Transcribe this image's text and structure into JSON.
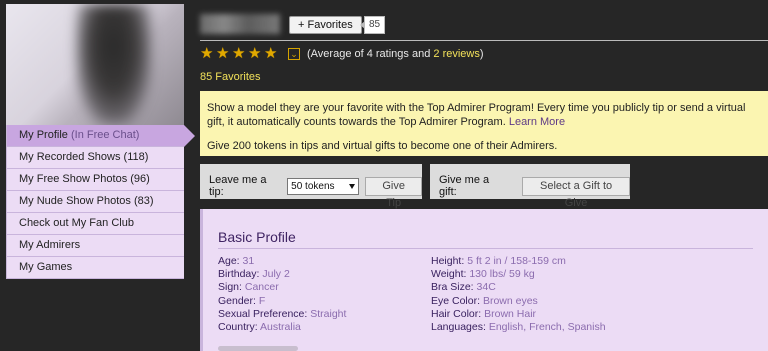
{
  "header": {
    "favorites_button": "+ Favorites",
    "favorites_count": "85",
    "rating_text": "(Average of 4 ratings and ",
    "reviews_link": "2 reviews",
    "rating_text_end": ")",
    "rating_stars": 5,
    "favorites_total": "85 Favorites"
  },
  "sidebar": {
    "items": [
      {
        "label": "My Profile",
        "extra": "(In Free Chat)"
      },
      {
        "label": "My Recorded Shows (118)"
      },
      {
        "label": "My Free Show Photos (96)"
      },
      {
        "label": "My Nude Show Photos (83)"
      },
      {
        "label": "Check out My Fan Club"
      },
      {
        "label": "My Admirers"
      },
      {
        "label": "My Games"
      }
    ]
  },
  "banner": {
    "text": "Show a model they are your favorite with the Top Admirer Program! Every time you publicly tip or send a virtual gift, it automatically counts towards the Top Admirer Program.",
    "learn_more": "Learn More",
    "text2": "Give 200 tokens in tips and virtual gifts to become one of their Admirers."
  },
  "tip": {
    "label": "Leave me a tip:",
    "selected": "50 tokens",
    "button": "Give Tip"
  },
  "gift": {
    "label": "Give me a gift:",
    "button": "Select a Gift to Give"
  },
  "profile": {
    "title": "Basic Profile",
    "left": [
      {
        "k": "Age:",
        "v": "31"
      },
      {
        "k": "Birthday:",
        "v": "July 2"
      },
      {
        "k": "Sign:",
        "v": "Cancer"
      },
      {
        "k": "Gender:",
        "v": "F"
      },
      {
        "k": "Sexual Preference:",
        "v": "Straight"
      },
      {
        "k": "Country:",
        "v": "Australia"
      }
    ],
    "right": [
      {
        "k": "Height:",
        "v": "5 ft 2 in / 158-159 cm"
      },
      {
        "k": "Weight:",
        "v": "130 lbs/ 59 kg"
      },
      {
        "k": "Bra Size:",
        "v": "34C"
      },
      {
        "k": "Eye Color:",
        "v": "Brown eyes"
      },
      {
        "k": "Hair Color:",
        "v": "Brown Hair"
      },
      {
        "k": "Languages:",
        "v": "English, French, Spanish"
      }
    ]
  },
  "colors": {
    "background": "#262626",
    "accent_yellow": "#f2e15a",
    "menu_bg": "#ecdcf5",
    "menu_active": "#c8a6e0",
    "banner_bg": "#fbf5b1",
    "star": "#e0a800"
  }
}
